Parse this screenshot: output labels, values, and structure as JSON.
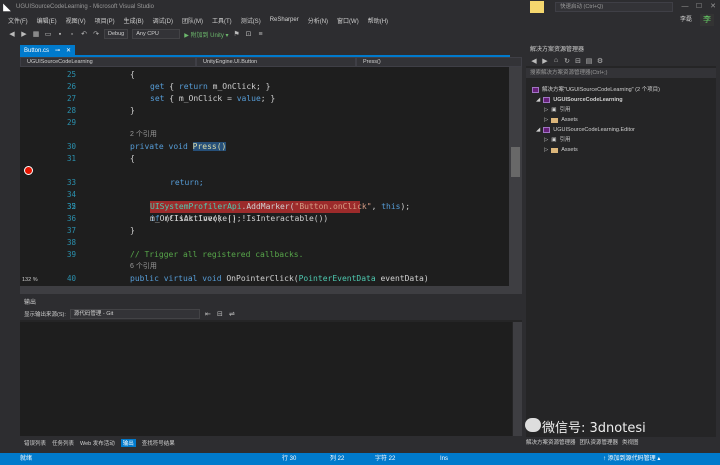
{
  "window": {
    "title": "UGUISourceCodeLearning - Microsoft Visual Studio",
    "quick_launch_placeholder": "快速启动 (Ctrl+Q)",
    "account": "李磊"
  },
  "menu": [
    "文件(F)",
    "编辑(E)",
    "视图(V)",
    "项目(P)",
    "生成(B)",
    "调试(D)",
    "团队(M)",
    "工具(T)",
    "测试(S)",
    "ReSharper",
    "分析(N)",
    "窗口(W)",
    "帮助(H)"
  ],
  "toolbar": {
    "config": "Debug",
    "platform": "Any CPU",
    "attach": "▶ 附加到 Unity ▾"
  },
  "document": {
    "tab_label": "Button.cs",
    "nav_project": "UGUISourceCodeLearning",
    "nav_class": "UnityEngine.UI.Button",
    "nav_member": "Press()"
  },
  "code": {
    "lines": [
      {
        "n": "25",
        "t": "{"
      },
      {
        "n": "26",
        "t": "get { return m_OnClick; }"
      },
      {
        "n": "27",
        "t": "set { m_OnClick = value; }"
      },
      {
        "n": "28",
        "t": "}"
      },
      {
        "n": "29",
        "t": ""
      },
      {
        "n": "",
        "t": "2 个引用"
      },
      {
        "n": "30",
        "t": "private void Press()"
      },
      {
        "n": "31",
        "t": "{"
      },
      {
        "n": "32",
        "t": "if (!IsActive() || !IsInteractable())"
      },
      {
        "n": "33",
        "t": "return;"
      },
      {
        "n": "34",
        "t": ""
      },
      {
        "n": "35",
        "t": "UISystemProfilerApi.AddMarker(\"Button.onClick\", this);"
      },
      {
        "n": "36",
        "t": "m_OnClick.Invoke();"
      },
      {
        "n": "37",
        "t": "}"
      },
      {
        "n": "38",
        "t": ""
      },
      {
        "n": "39",
        "t": "// Trigger all registered callbacks."
      },
      {
        "n": "",
        "t": "6 个引用"
      },
      {
        "n": "40",
        "t": "public virtual void OnPointerClick(PointerEventData eventData)"
      }
    ],
    "zoom": "132 %"
  },
  "output": {
    "title": "输出",
    "source_label": "显示输出来源(S):",
    "source_value": "源代码管理 - Git"
  },
  "bottom_tabs": [
    "错误列表",
    "任务列表",
    "Web 发布活动",
    "输出",
    "查找符号结果"
  ],
  "solution": {
    "title": "解决方案资源管理器",
    "search_placeholder": "搜索解决方案资源管理器(Ctrl+;)",
    "root": "解决方案\"UGUISourceCodeLearning\" (2 个项目)",
    "proj1": "UGUISourceCodeLearning",
    "ref1": "引用",
    "assets1": "Assets",
    "proj2": "UGUISourceCodeLearning.Editor",
    "ref2": "引用",
    "assets2": "Assets",
    "bottom_tabs": [
      "解决方案资源管理器",
      "团队资源管理器",
      "类视图"
    ]
  },
  "status": {
    "ready": "就绪",
    "line": "行 30",
    "col": "列 22",
    "char": "字符 22",
    "mode": "Ins",
    "source_control": "↑ 添加到源代码管理 ▴"
  },
  "watermark": "微信号: 3dnotesi"
}
